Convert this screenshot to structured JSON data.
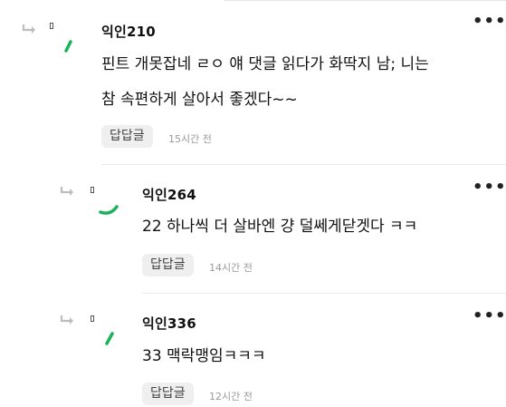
{
  "comments": [
    {
      "author": "익인210",
      "body_lines": [
        "핀트 개못잡네 ㄹㅇ 얘 댓글 읽다가 화딱지 남; 니는",
        "참 속편하게 살아서 좋겠다~~"
      ],
      "reply_label": "답답글",
      "time": "15시간 전",
      "more": "•••"
    },
    {
      "author": "익인264",
      "body_lines": [
        "22 하나씩 더 살바엔 걍 덜쎄게닫겟다 ㅋㅋ"
      ],
      "reply_label": "답답글",
      "time": "14시간 전",
      "more": "•••"
    },
    {
      "author": "익인336",
      "body_lines": [
        "33 맥락맹임ㅋㅋㅋ"
      ],
      "reply_label": "답답글",
      "time": "12시간 전",
      "more": "•••"
    }
  ],
  "colors": {
    "accent_green": "#19b35a",
    "reply_bg": "#efefef",
    "time_gray": "#9a9a9a"
  },
  "icons": {
    "reply_arrow": "reply-arrow-icon",
    "more": "more-options-icon"
  }
}
